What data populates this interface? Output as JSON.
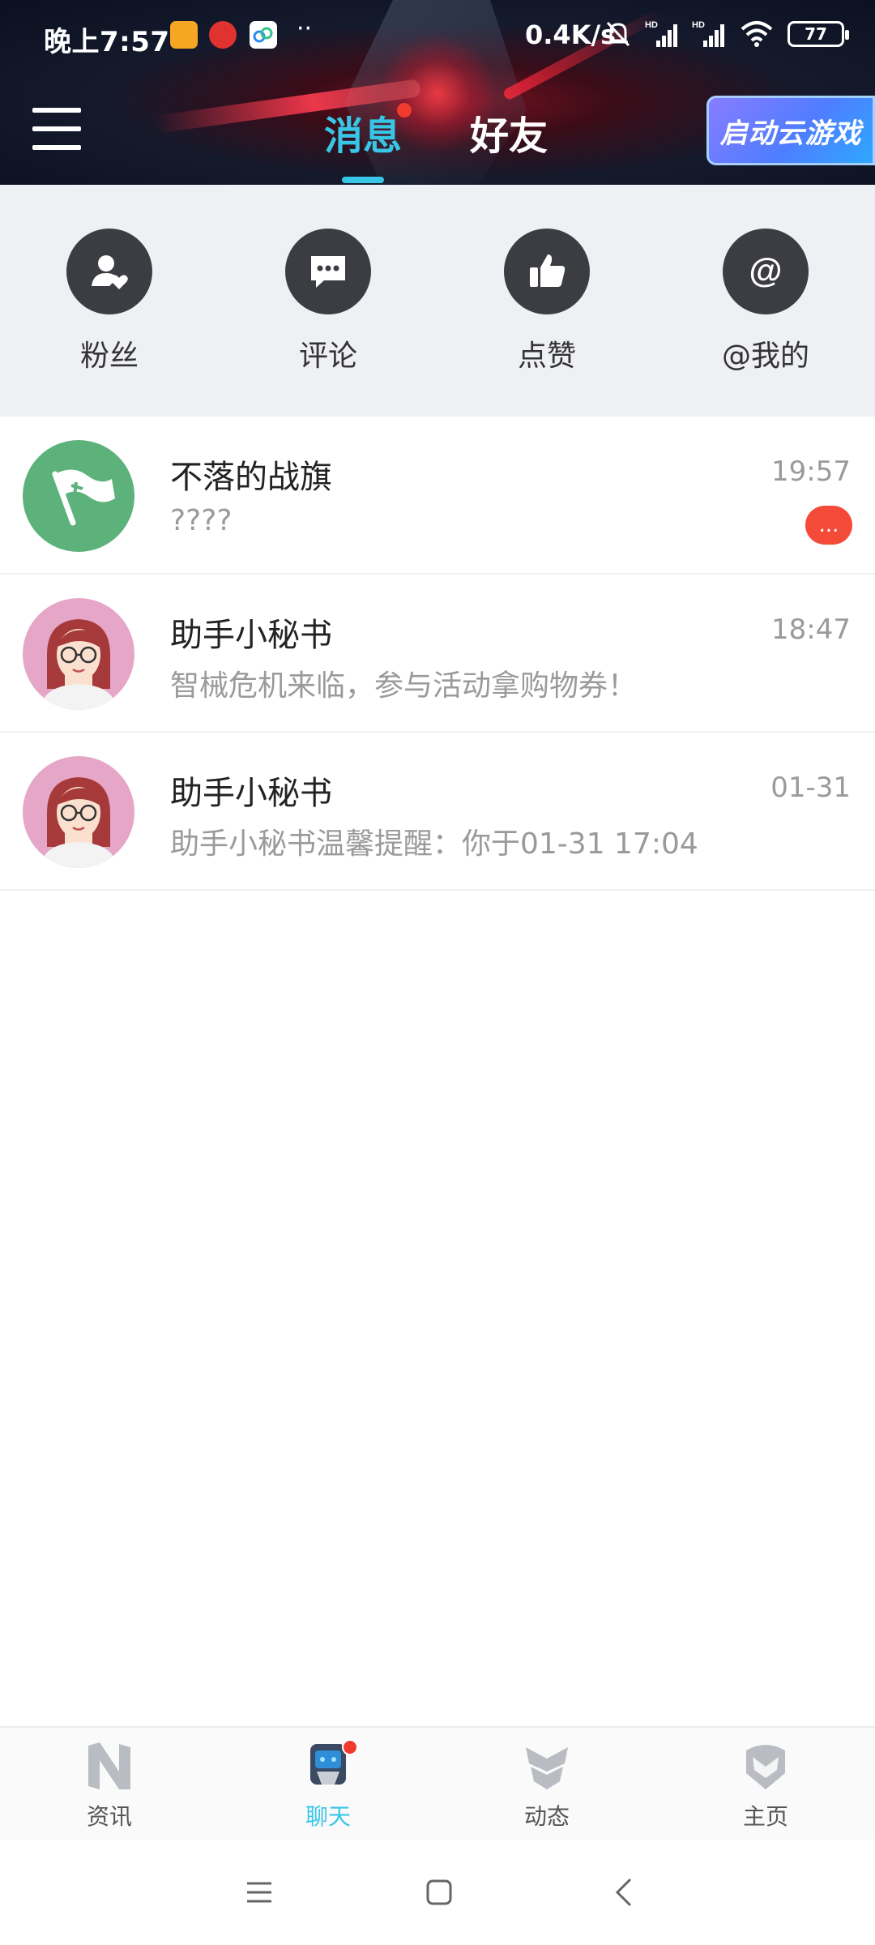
{
  "status_bar": {
    "time": "晚上7:57",
    "network_speed": "0.4K/s",
    "battery": "77",
    "icons": [
      "gallery-icon",
      "app-icon",
      "cloud-icon",
      "bell-muted-icon",
      "signal-hd-icon",
      "signal-hd-icon",
      "wifi-icon",
      "battery-icon"
    ]
  },
  "header": {
    "tabs": [
      {
        "label": "消息",
        "active": true,
        "has_dot": true
      },
      {
        "label": "好友",
        "active": false,
        "has_dot": false
      }
    ],
    "cloud_game_button": "启动云游戏",
    "menu_icon": "menu-icon",
    "accent_color": "#37c6e6"
  },
  "quick_actions": [
    {
      "label": "粉丝",
      "icon": "fans-icon"
    },
    {
      "label": "评论",
      "icon": "comment-icon"
    },
    {
      "label": "点赞",
      "icon": "thumbs-up-icon"
    },
    {
      "label": "@我的",
      "icon": "at-icon"
    }
  ],
  "chats": [
    {
      "name": "不落的战旗",
      "preview": "????",
      "time": "19:57",
      "badge": "...",
      "avatar": "flag-avatar"
    },
    {
      "name": "助手小秘书",
      "preview": "智械危机来临，参与活动拿购物券！",
      "time": "18:47",
      "badge": "",
      "avatar": "assistant-avatar"
    },
    {
      "name": "助手小秘书",
      "preview": "助手小秘书温馨提醒：你于01-31 17:04",
      "time": "01-31",
      "badge": "",
      "avatar": "assistant-avatar"
    }
  ],
  "bottom_nav": [
    {
      "label": "资讯",
      "icon": "news-icon",
      "active": false
    },
    {
      "label": "聊天",
      "icon": "chat-robot-icon",
      "active": true,
      "has_dot": true
    },
    {
      "label": "动态",
      "icon": "feed-icon",
      "active": false
    },
    {
      "label": "主页",
      "icon": "home-helmet-icon",
      "active": false
    }
  ],
  "system_nav": [
    "recents-icon",
    "home-icon",
    "back-icon"
  ]
}
